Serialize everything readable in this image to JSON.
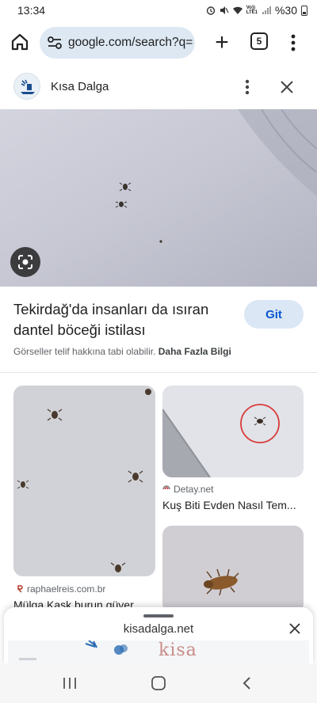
{
  "status_bar": {
    "time": "13:34",
    "network_label": "Vo))\nLTE1",
    "battery": "%30"
  },
  "browser": {
    "url": "google.com/search?q=",
    "tab_count": "5",
    "new_tab_symbol": "+"
  },
  "result": {
    "site_name": "Kısa Dalga",
    "headline": "Tekirdağ'da insanları da ısıran dantel böceği istilası",
    "visit_label": "Git",
    "copyright_text": "Görseller telif hakkına tabi olabilir.",
    "more_info_label": "Daha Fazla Bilgi"
  },
  "related": [
    {
      "source": "raphaelreis.com.br",
      "title": "Mülga Kask burun güver..."
    },
    {
      "source": "Detay.net",
      "title": "Kuş Biti Evden Nasıl Tem..."
    },
    {
      "source": "",
      "title": ""
    }
  ],
  "sheet": {
    "title": "kisadalga.net",
    "preview_brand": "kisa"
  },
  "colors": {
    "accent": "#0b57d0",
    "url_bar": "#dde8f3",
    "visit_button": "#dbe7f5"
  },
  "icons": [
    "home-icon",
    "site-settings-icon",
    "plus-icon",
    "tabs-icon",
    "more-vert-icon",
    "close-icon",
    "google-lens-icon",
    "recents-icon",
    "home-nav-icon",
    "back-icon"
  ]
}
